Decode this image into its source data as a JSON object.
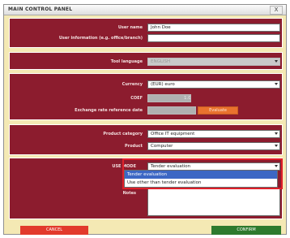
{
  "window": {
    "title": "MAIN CONTROL PANEL",
    "close_label": "X"
  },
  "user": {
    "name_label": "User name",
    "name_value": "John Doe",
    "info_label": "User information (e.g. office/branch)",
    "info_value": ""
  },
  "language": {
    "label": "Tool language",
    "value": "ENGLISH"
  },
  "currency": {
    "label": "Currency",
    "value": "(EUR) euro",
    "coef_label": "COEF",
    "coef_value": "1.00",
    "exchange_label": "Exchange rate reference date",
    "exchange_value": "",
    "evaluate_label": "Evaluate"
  },
  "product": {
    "category_label": "Product category",
    "category_value": "Office IT equipment",
    "product_label": "Product",
    "product_value": "Computer"
  },
  "use_mode": {
    "label": "USE MODE",
    "value": "Tender evaluation",
    "options": [
      "Tender evaluation",
      "Use other than tender evaluation"
    ]
  },
  "notes": {
    "label": "Notes",
    "value": ""
  },
  "buttons": {
    "cancel": "CANCEL",
    "confirm": "CONFIRM"
  }
}
